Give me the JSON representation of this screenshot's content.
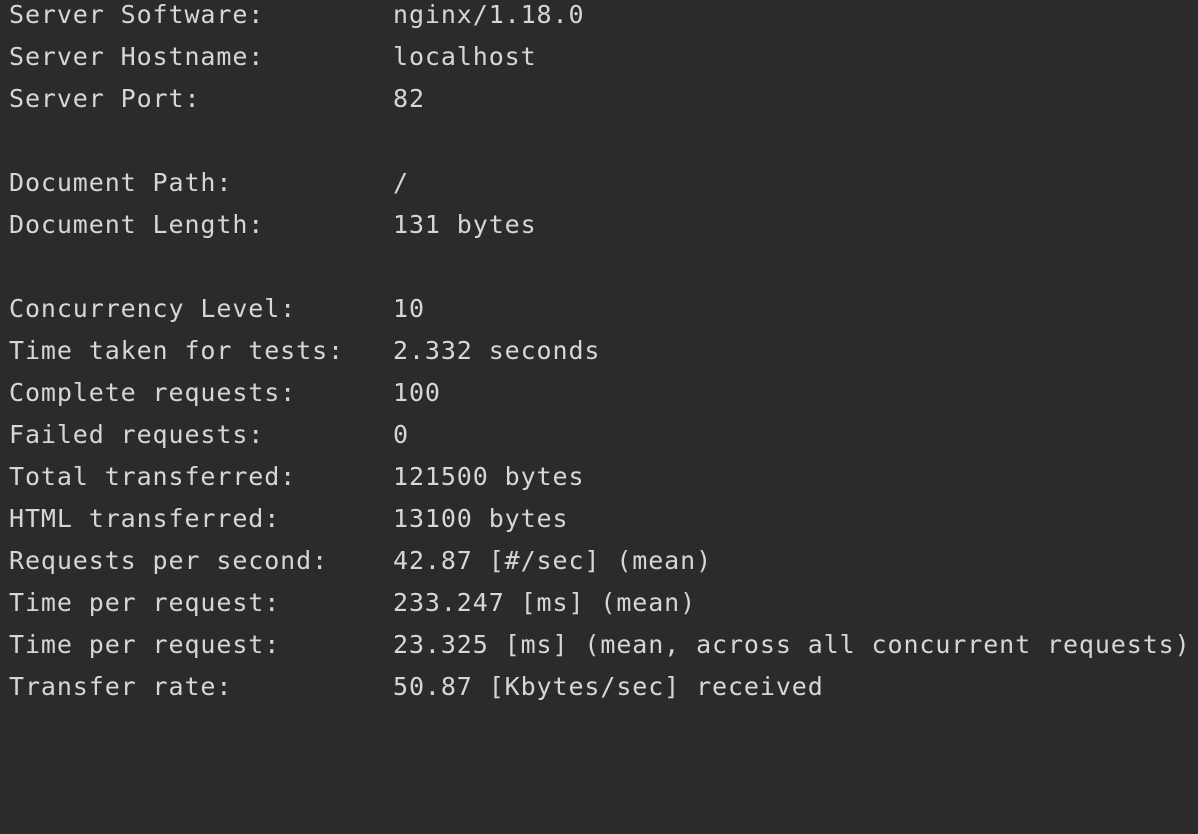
{
  "output": {
    "lines": [
      {
        "key": "Server Software:",
        "value": "nginx/1.18.0"
      },
      {
        "key": "Server Hostname:",
        "value": "localhost"
      },
      {
        "key": "Server Port:",
        "value": "82"
      },
      {
        "key": "Document Path:",
        "value": "/"
      },
      {
        "key": "Document Length:",
        "value": "131 bytes"
      },
      {
        "key": "Concurrency Level:",
        "value": "10"
      },
      {
        "key": "Time taken for tests:",
        "value": "2.332 seconds"
      },
      {
        "key": "Complete requests:",
        "value": "100"
      },
      {
        "key": "Failed requests:",
        "value": "0"
      },
      {
        "key": "Total transferred:",
        "value": "121500 bytes"
      },
      {
        "key": "HTML transferred:",
        "value": "13100 bytes"
      },
      {
        "key": "Requests per second:",
        "value": "42.87 [#/sec] (mean)"
      },
      {
        "key": "Time per request:",
        "value": "233.247 [ms] (mean)"
      },
      {
        "key": "Time per request:",
        "value": "23.325 [ms] (mean, across all concurrent requests)"
      },
      {
        "key": "Transfer rate:",
        "value": "50.87 [Kbytes/sec] received"
      }
    ]
  }
}
